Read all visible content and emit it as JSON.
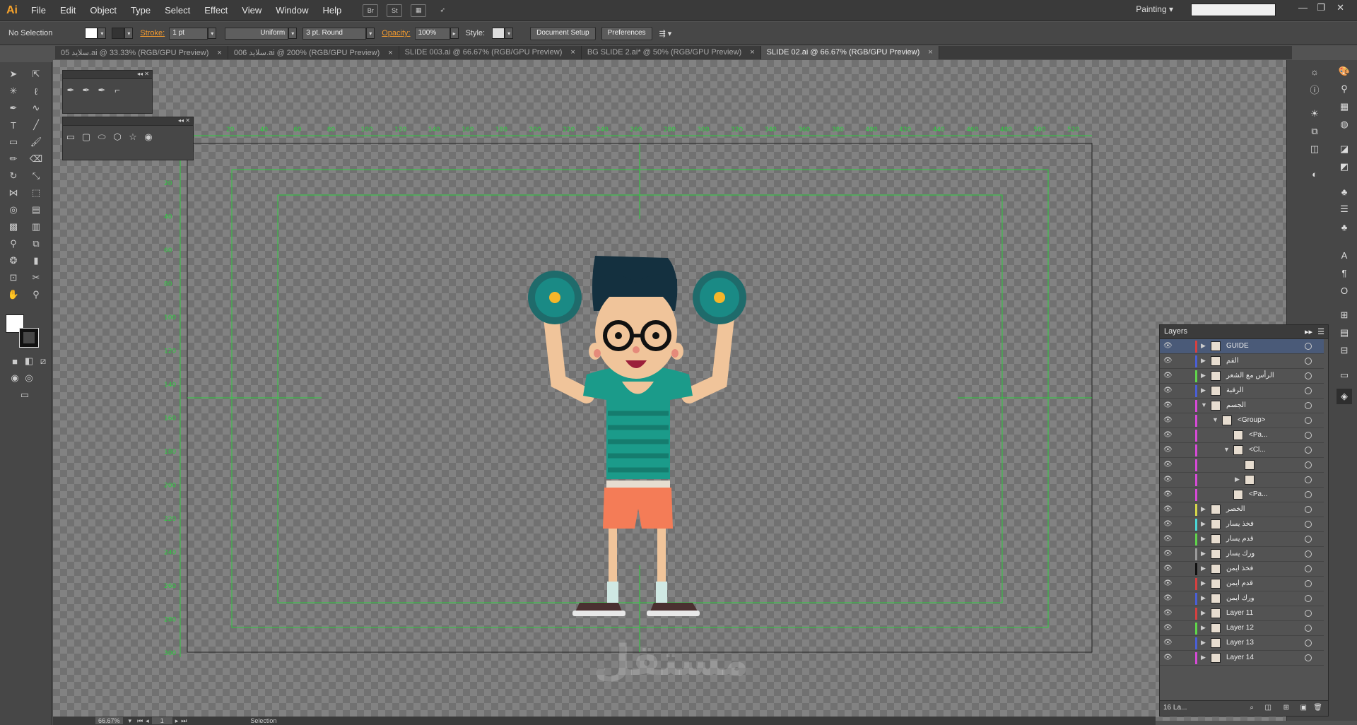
{
  "app": {
    "logo": "Ai",
    "workspace": "Painting",
    "search_placeholder": ""
  },
  "menu": [
    "File",
    "Edit",
    "Object",
    "Type",
    "Select",
    "Effect",
    "View",
    "Window",
    "Help"
  ],
  "menubar_icons": [
    "Br",
    "St",
    "arrange-documents-icon",
    "gpu-performance-icon"
  ],
  "control": {
    "selection": "No Selection",
    "stroke_label": "Stroke:",
    "stroke_weight": "1 pt",
    "stroke_profile": "Uniform",
    "brush": "3 pt. Round",
    "opacity_label": "Opacity:",
    "opacity": "100%",
    "style_label": "Style:",
    "doc_setup": "Document Setup",
    "preferences": "Preferences"
  },
  "tabs": [
    {
      "label": "05 سلايد.ai @ 33.33% (RGB/GPU Preview)",
      "close": "×"
    },
    {
      "label": "006 سلايد.ai @ 200% (RGB/GPU Preview)",
      "close": "×"
    },
    {
      "label": "SLIDE 003.ai @ 66.67% (RGB/GPU Preview)",
      "close": "×"
    },
    {
      "label": "BG SLIDE 2.ai* @ 50% (RGB/GPU Preview)",
      "close": "×"
    },
    {
      "label": "SLIDE 02.ai @ 66.67% (RGB/GPU Preview)",
      "close": "×"
    }
  ],
  "active_tab": 4,
  "layers": {
    "title": "Layers",
    "rows": [
      {
        "name": "GUIDE",
        "color": "#d64040",
        "level": 0,
        "expand": "▶",
        "selected": true
      },
      {
        "name": "الفم",
        "color": "#4a5fd6",
        "level": 0,
        "expand": "▶"
      },
      {
        "name": "الرأس مع الشعر",
        "color": "#5fd64a",
        "level": 0,
        "expand": "▶"
      },
      {
        "name": "الرقبة",
        "color": "#4a5fd6",
        "level": 0,
        "expand": "▶"
      },
      {
        "name": "الجسم",
        "color": "#d64ad6",
        "level": 0,
        "expand": "▼"
      },
      {
        "name": "<Group>",
        "color": "#d64ad6",
        "level": 1,
        "expand": "▼"
      },
      {
        "name": "<Pa...",
        "color": "#d64ad6",
        "level": 2,
        "expand": ""
      },
      {
        "name": "<Cl...",
        "color": "#d64ad6",
        "level": 2,
        "expand": "▼"
      },
      {
        "name": "",
        "color": "#d64ad6",
        "level": 3,
        "expand": ""
      },
      {
        "name": "",
        "color": "#d64ad6",
        "level": 3,
        "expand": "▶"
      },
      {
        "name": "<Pa...",
        "color": "#d64ad6",
        "level": 2,
        "expand": ""
      },
      {
        "name": "الخصر",
        "color": "#d6d64a",
        "level": 0,
        "expand": "▶"
      },
      {
        "name": "فخذ يسار",
        "color": "#4ad6d6",
        "level": 0,
        "expand": "▶"
      },
      {
        "name": "قدم يسار",
        "color": "#5fd64a",
        "level": 0,
        "expand": "▶"
      },
      {
        "name": "ورك يسار",
        "color": "#9a9a9a",
        "level": 0,
        "expand": "▶"
      },
      {
        "name": "فخذ ايمن",
        "color": "#111111",
        "level": 0,
        "expand": "▶"
      },
      {
        "name": "قدم ايمن",
        "color": "#d64040",
        "level": 0,
        "expand": "▶"
      },
      {
        "name": "ورك ايمن",
        "color": "#4a5fd6",
        "level": 0,
        "expand": "▶"
      },
      {
        "name": "Layer 11",
        "color": "#d64040",
        "level": 0,
        "expand": "▶"
      },
      {
        "name": "Layer 12",
        "color": "#5fd64a",
        "level": 0,
        "expand": "▶"
      },
      {
        "name": "Layer 13",
        "color": "#4a5fd6",
        "level": 0,
        "expand": "▶"
      },
      {
        "name": "Layer 14",
        "color": "#d64ad6",
        "level": 0,
        "expand": "▶"
      }
    ],
    "footer": "16 La..."
  },
  "status": {
    "zoom": "66.67%",
    "page": "1",
    "tool": "Selection"
  },
  "ruler_labels": [
    "20",
    "40",
    "60",
    "80",
    "100",
    "120",
    "140",
    "160",
    "180",
    "200",
    "220",
    "240",
    "260",
    "280",
    "300",
    "320",
    "340",
    "360",
    "380",
    "400",
    "420",
    "440",
    "460",
    "480",
    "500",
    "520"
  ],
  "watermark": "مستقل"
}
